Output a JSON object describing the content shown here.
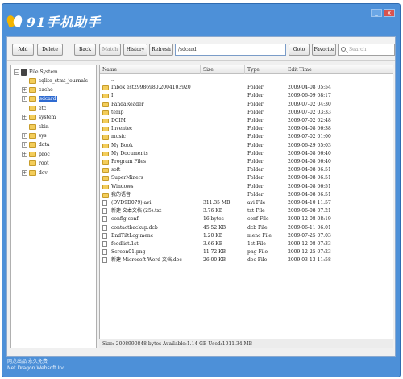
{
  "app": {
    "title": "91手机助手",
    "footer_line1": "网龙出品 永久免费",
    "footer_line2": "Net Dragon Websoft Inc.",
    "accent_color": "#4d90d8"
  },
  "window_controls": {
    "minimize": "_",
    "close": "x"
  },
  "toolbar": {
    "add": "Add",
    "delete": "Delete",
    "back": "Back",
    "match": "Match",
    "history": "History",
    "refresh": "Refresh",
    "path_value": "/sdcard",
    "goto": "Goto",
    "favorite": "Favorite",
    "search_placeholder": "Search"
  },
  "tree": {
    "root": "File System",
    "items": [
      {
        "label": "sqlite_stmt_journals",
        "expandable": false,
        "selected": false
      },
      {
        "label": "cache",
        "expandable": true,
        "selected": false
      },
      {
        "label": "sdcard",
        "expandable": true,
        "selected": true
      },
      {
        "label": "etc",
        "expandable": false,
        "selected": false
      },
      {
        "label": "system",
        "expandable": true,
        "selected": false
      },
      {
        "label": "sbin",
        "expandable": false,
        "selected": false
      },
      {
        "label": "sys",
        "expandable": true,
        "selected": false
      },
      {
        "label": "data",
        "expandable": true,
        "selected": false
      },
      {
        "label": "proc",
        "expandable": true,
        "selected": false
      },
      {
        "label": "root",
        "expandable": false,
        "selected": false
      },
      {
        "label": "dev",
        "expandable": true,
        "selected": false
      }
    ]
  },
  "list": {
    "columns": [
      "Name",
      "Size",
      "Type",
      "Edit Time"
    ],
    "rows": [
      {
        "name": "..",
        "size": "",
        "type": "",
        "time": "",
        "icon": "none"
      },
      {
        "name": "Inbox est29986980.2004103920",
        "size": "",
        "type": "Folder",
        "time": "2009-04-08 05:54",
        "icon": "folder"
      },
      {
        "name": "I",
        "size": "",
        "type": "Folder",
        "time": "2009-06-09 08:17",
        "icon": "folder"
      },
      {
        "name": "PandaReader",
        "size": "",
        "type": "Folder",
        "time": "2009-07-02 04:30",
        "icon": "folder"
      },
      {
        "name": "temp",
        "size": "",
        "type": "Folder",
        "time": "2009-07-02 03:33",
        "icon": "folder"
      },
      {
        "name": "DCIM",
        "size": "",
        "type": "Folder",
        "time": "2009-07-02 02:48",
        "icon": "folder"
      },
      {
        "name": "Inventec",
        "size": "",
        "type": "Folder",
        "time": "2009-04-08 06:38",
        "icon": "folder"
      },
      {
        "name": "music",
        "size": "",
        "type": "Folder",
        "time": "2009-07-02 01:00",
        "icon": "folder"
      },
      {
        "name": "My Book",
        "size": "",
        "type": "Folder",
        "time": "2009-06-29 05:03",
        "icon": "folder"
      },
      {
        "name": "My Documents",
        "size": "",
        "type": "Folder",
        "time": "2009-04-08 06:40",
        "icon": "folder"
      },
      {
        "name": "Program Files",
        "size": "",
        "type": "Folder",
        "time": "2009-04-08 06:40",
        "icon": "folder"
      },
      {
        "name": "soft",
        "size": "",
        "type": "Folder",
        "time": "2009-04-08 06:51",
        "icon": "folder"
      },
      {
        "name": "SuperMiners",
        "size": "",
        "type": "Folder",
        "time": "2009-04-08 06:51",
        "icon": "folder"
      },
      {
        "name": "Windows",
        "size": "",
        "type": "Folder",
        "time": "2009-04-08 06:51",
        "icon": "folder"
      },
      {
        "name": "我的语音",
        "size": "",
        "type": "Folder",
        "time": "2009-04-08 06:51",
        "icon": "folder"
      },
      {
        "name": "(DVD9D079).avi",
        "size": "311.35 MB",
        "type": "avi File",
        "time": "2009-04-10 11:57",
        "icon": "file"
      },
      {
        "name": "新建 文本文档 (25).txt",
        "size": "3.76 KB",
        "type": "txt File",
        "time": "2009-06-08 07:21",
        "icon": "file"
      },
      {
        "name": "config.conf",
        "size": "16 bytes",
        "type": "conf File",
        "time": "2009-12-08 08:19",
        "icon": "file"
      },
      {
        "name": "contactbackup.dcb",
        "size": "45.52 KB",
        "type": "dcb File",
        "time": "2009-06-11 06:01",
        "icon": "file"
      },
      {
        "name": "EndTiltLog.menc",
        "size": "1.20 KB",
        "type": "menc File",
        "time": "2009-07-25 07:03",
        "icon": "file"
      },
      {
        "name": "feedlist.1st",
        "size": "3.66 KB",
        "type": "1st File",
        "time": "2009-12-08 07:33",
        "icon": "file"
      },
      {
        "name": "Screen01.png",
        "size": "11.72 KB",
        "type": "png File",
        "time": "2009-12-25 07:23",
        "icon": "file"
      },
      {
        "name": "新建 Microsoft Word 文档.doc",
        "size": "26.00 KB",
        "type": "doc File",
        "time": "2009-03-13 11:58",
        "icon": "file"
      }
    ]
  },
  "status": {
    "text": "Size:-2008990848 bytes  Available:1.14 GB  Used:1011.34 MB"
  }
}
